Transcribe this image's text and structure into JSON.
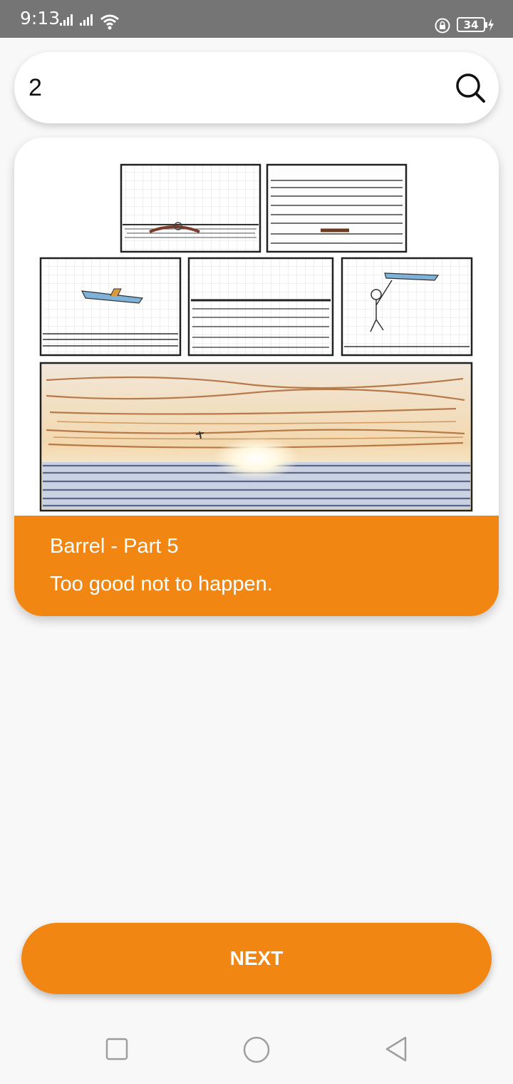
{
  "status_bar": {
    "time": "9:13",
    "battery": "34"
  },
  "search": {
    "value": "2",
    "icon": "search-icon"
  },
  "card": {
    "title": "Barrel - Part 5",
    "subtitle": "Too good not to happen."
  },
  "next_button": {
    "label": "NEXT"
  },
  "colors": {
    "accent": "#f28613",
    "status_bar": "#757575",
    "background": "#f8f8f8"
  },
  "nav": {
    "icons": [
      "recents-icon",
      "home-icon",
      "back-icon"
    ]
  }
}
